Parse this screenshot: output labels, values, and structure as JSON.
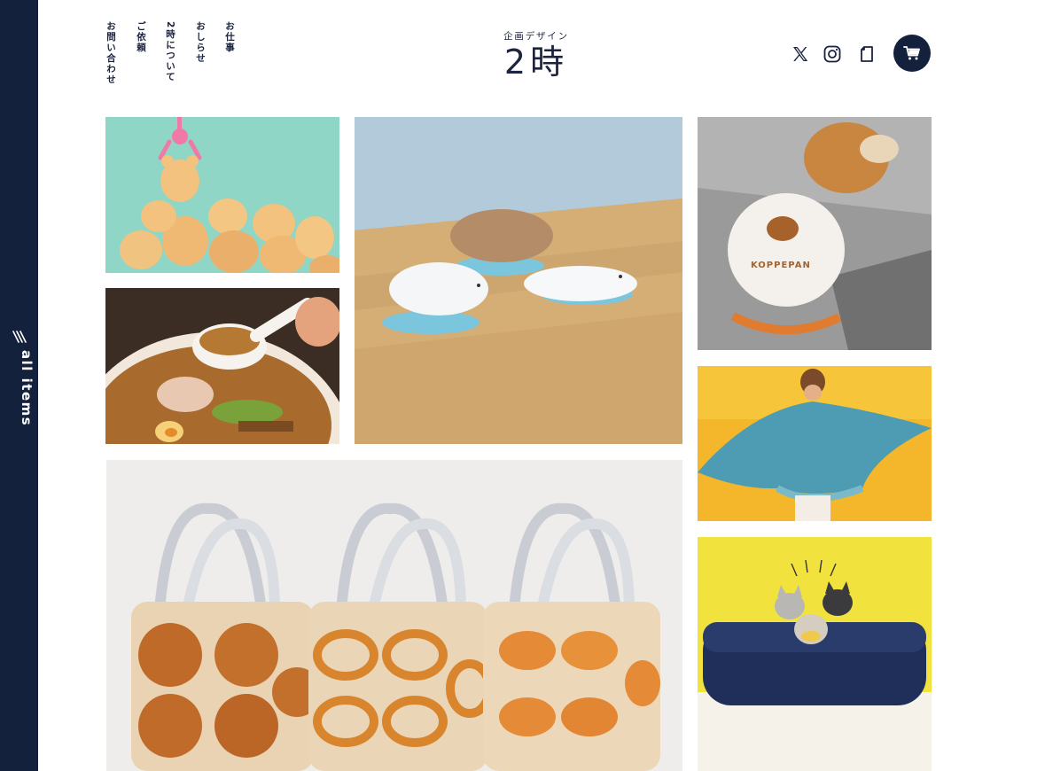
{
  "rail": {
    "label": "all items",
    "icon": "triple-slash-icon"
  },
  "nav": {
    "items": [
      {
        "label": "お仕事"
      },
      {
        "label": "おしらせ"
      },
      {
        "label": "2時について"
      },
      {
        "label": "ご依頼"
      },
      {
        "label": "お問い合わせ"
      }
    ]
  },
  "logo": {
    "sub": "企画デザイン",
    "main": "2時"
  },
  "header_icons": [
    "x-logo-icon",
    "instagram-icon",
    "note-icon",
    "cart-icon"
  ],
  "colors": {
    "navy": "#14213d",
    "text": "#1b2340",
    "background": "#ffffff"
  },
  "gallery": [
    {
      "id": "bear-sweets",
      "alt": "UFO catcher bear sweets"
    },
    {
      "id": "seal-figures",
      "alt": "seal and bird figures on box"
    },
    {
      "id": "shiba-shirt",
      "alt": "shiba dog wearing KOPPEPAN t-shirt"
    },
    {
      "id": "ramen-spoon",
      "alt": "ramen bowl with spoon"
    },
    {
      "id": "manta-poncho",
      "alt": "person wearing manta ray poncho"
    },
    {
      "id": "bread-bags",
      "alt": "bread pattern tote bags"
    },
    {
      "id": "cat-pouch",
      "alt": "navy pouch with cat clips"
    }
  ],
  "shirt_print": "KOPPEPAN"
}
